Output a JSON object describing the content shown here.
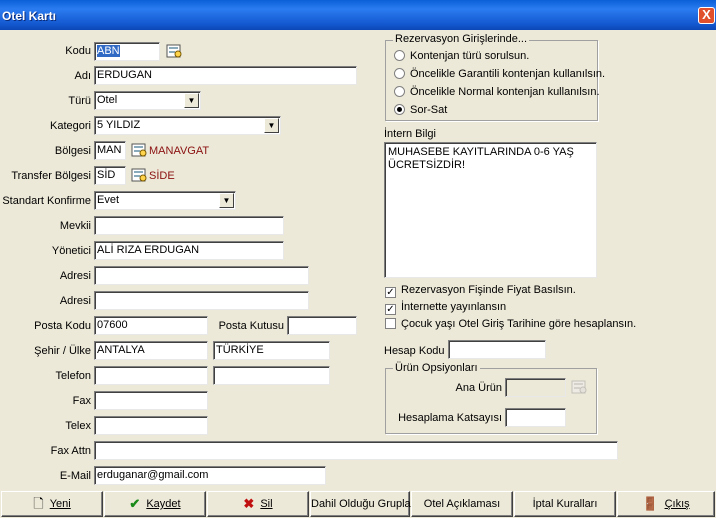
{
  "window": {
    "title": "Otel Kartı",
    "close": "X"
  },
  "fields": {
    "kod": {
      "label": "Kodu",
      "value": "ABN"
    },
    "adi": {
      "label": "Adı",
      "value": "ERDUGAN"
    },
    "turu": {
      "label": "Türü",
      "value": "Otel"
    },
    "kategori": {
      "label": "Kategori",
      "value": "5 YILDIZ"
    },
    "bolgesi": {
      "label": "Bölgesi",
      "value": "MAN",
      "name": "MANAVGAT"
    },
    "transfer": {
      "label": "Transfer Bölgesi",
      "value": "SİD",
      "name": "SİDE"
    },
    "konfirme": {
      "label": "Standart Konfirme",
      "value": "Evet"
    },
    "mevkii": {
      "label": "Mevkii",
      "value": ""
    },
    "yonetici": {
      "label": "Yönetici",
      "value": "ALİ RIZA ERDUGAN"
    },
    "adres1": {
      "label": "Adresi",
      "value": ""
    },
    "adres2": {
      "label": "Adresi",
      "value": ""
    },
    "postakodu": {
      "label": "Posta Kodu",
      "value": "07600"
    },
    "postakutusu": {
      "label": "Posta Kutusu",
      "value": ""
    },
    "sehir": {
      "label": "Şehir / Ülke",
      "city": "ANTALYA",
      "country": "TÜRKİYE"
    },
    "telefon": {
      "label": "Telefon",
      "value1": "",
      "value2": ""
    },
    "fax": {
      "label": "Fax",
      "value": ""
    },
    "telex": {
      "label": "Telex",
      "value": ""
    },
    "faxattn": {
      "label": "Fax Attn",
      "value": ""
    },
    "email": {
      "label": "E-Mail",
      "value": "erduganar@gmail.com"
    }
  },
  "rezervasyon": {
    "title": "Rezervasyon Girişlerinde...",
    "options": [
      {
        "label": "Kontenjan türü sorulsun.",
        "checked": false
      },
      {
        "label": "Öncelikle Garantili kontenjan kullanılsın.",
        "checked": false
      },
      {
        "label": "Öncelikle Normal kontenjan kullanılsın.",
        "checked": false
      },
      {
        "label": "Sor-Sat",
        "checked": true
      }
    ]
  },
  "intern": {
    "label": "İntern Bilgi",
    "text": "MUHASEBE KAYITLARINDA 0-6 YAŞ\nÜCRETSİZDİR!"
  },
  "checks": [
    {
      "label": "Rezervasyon Fişinde Fiyat Basılsın.",
      "checked": true
    },
    {
      "label": "İnternette yayınlansın",
      "checked": true
    },
    {
      "label": "Çocuk yaşı Otel Giriş Tarihine göre hesaplansın.",
      "checked": false
    }
  ],
  "hesap": {
    "label": "Hesap Kodu",
    "value": ""
  },
  "urun": {
    "title": "Ürün Opsiyonları",
    "ana_label": "Ana Ürün",
    "ana_value": "",
    "katsayi_label": "Hesaplama Katsayısı",
    "katsayi_value": ""
  },
  "buttons": {
    "yeni": "Yeni",
    "kaydet": "Kaydet",
    "sil": "Sil",
    "dahil": "Dahil Olduğu Gruplar",
    "aciklama": "Otel Açıklaması",
    "iptal": "İptal Kuralları",
    "cikis": "Çıkış"
  },
  "colors": {
    "title_bar": "#1458d0",
    "selection": "#316ac5",
    "region_name": "#8a1010",
    "face": "#ece9d8"
  },
  "icons": [
    "lookup-icon",
    "new-doc-icon",
    "check-icon",
    "delete-x-icon",
    "exit-door-icon",
    "close-icon"
  ]
}
